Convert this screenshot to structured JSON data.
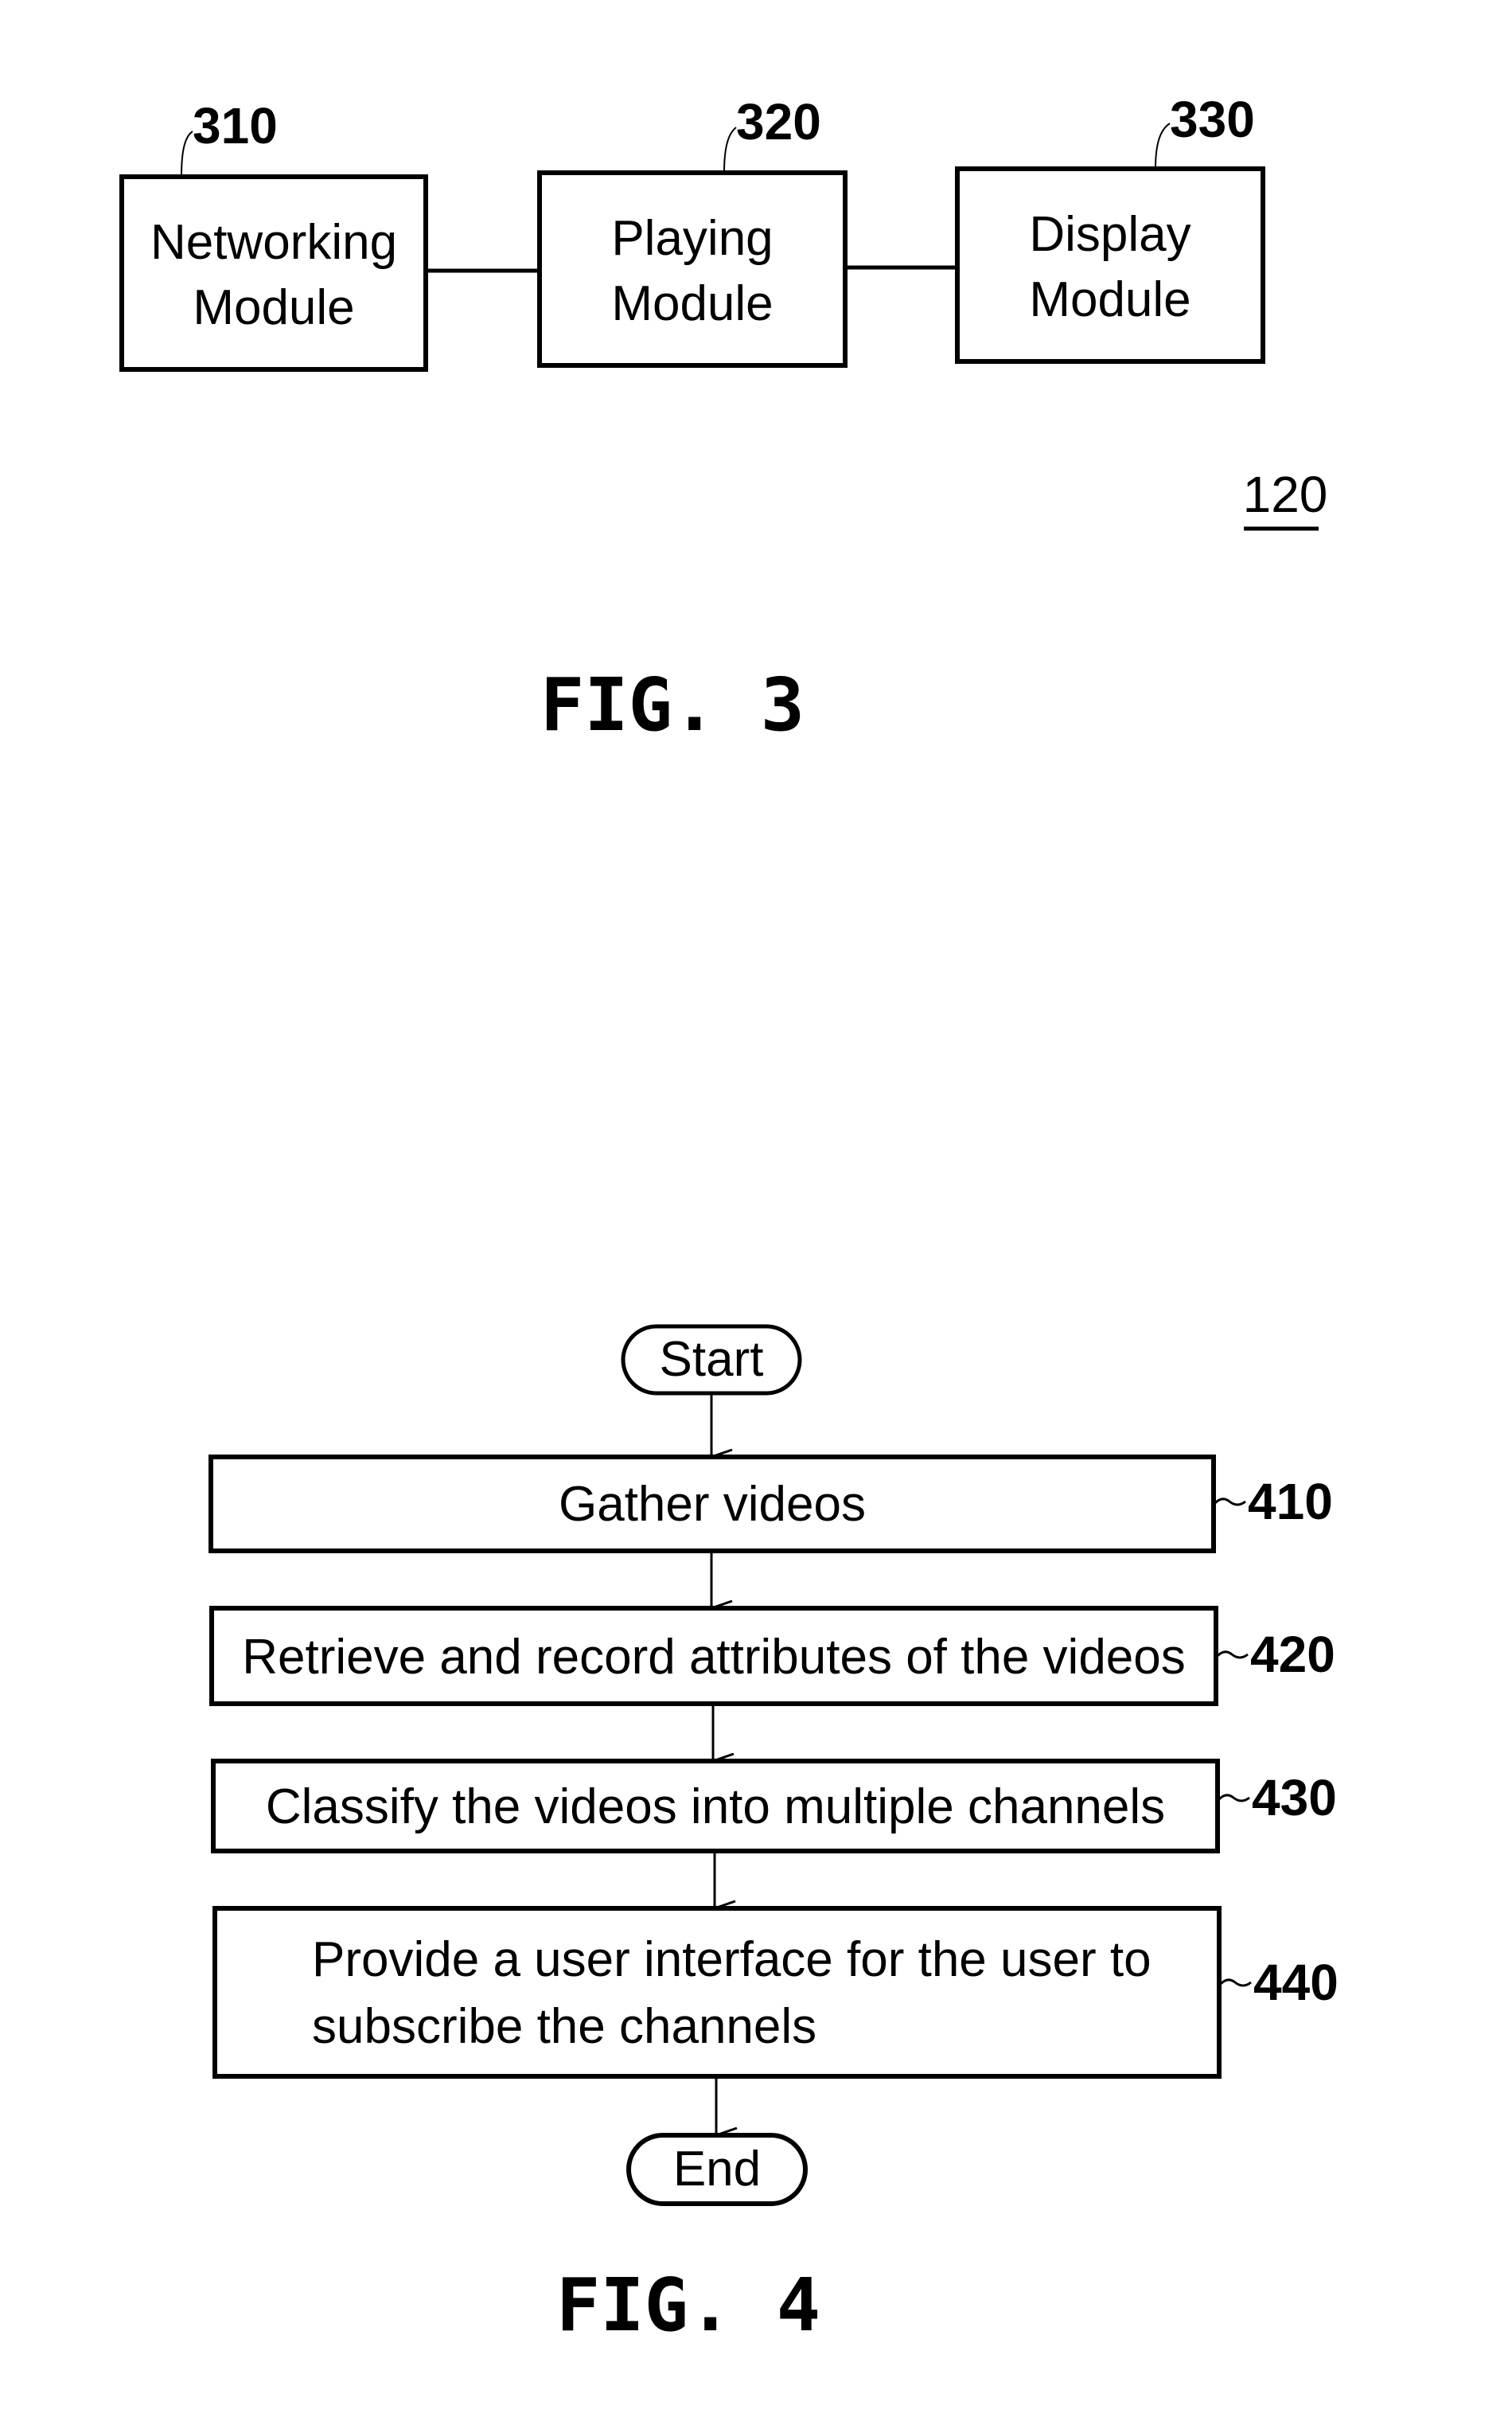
{
  "fig3": {
    "caption": "FIG. 3",
    "system_ref": "120",
    "modules": [
      {
        "ref": "310",
        "lines": [
          "Networking",
          "Module"
        ]
      },
      {
        "ref": "320",
        "lines": [
          "Playing",
          "Module"
        ]
      },
      {
        "ref": "330",
        "lines": [
          "Display",
          "Module"
        ]
      }
    ]
  },
  "fig4": {
    "caption": "FIG. 4",
    "start_label": "Start",
    "end_label": "End",
    "steps": [
      {
        "ref": "410",
        "lines": [
          "Gather videos"
        ]
      },
      {
        "ref": "420",
        "lines": [
          "Retrieve and record attributes of the videos"
        ]
      },
      {
        "ref": "430",
        "lines": [
          "Classify the videos into multiple channels"
        ]
      },
      {
        "ref": "440",
        "lines": [
          "Provide a user interface for the user to",
          "subscribe the channels"
        ]
      }
    ]
  }
}
